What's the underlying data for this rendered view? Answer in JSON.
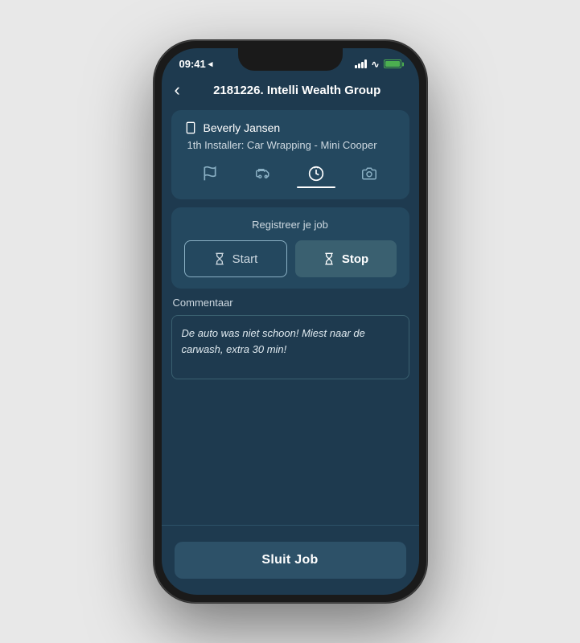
{
  "status_bar": {
    "time": "09:41",
    "location_icon": "◂",
    "wifi_icon": "wifi",
    "battery_label": "battery"
  },
  "header": {
    "back_label": "‹",
    "title_number": "2181226.",
    "title_name": " Intelli Wealth Group"
  },
  "customer": {
    "name": "Beverly Jansen",
    "installer_text": "1th Installer: Car Wrapping - Mini Cooper"
  },
  "tabs": [
    {
      "id": "flag",
      "icon": "🚩",
      "label": "flag",
      "active": false
    },
    {
      "id": "car",
      "icon": "🚗",
      "label": "car",
      "active": false
    },
    {
      "id": "clock",
      "icon": "⏰",
      "label": "clock",
      "active": true
    },
    {
      "id": "camera",
      "icon": "📷",
      "label": "camera",
      "active": false
    }
  ],
  "job_register": {
    "title": "Registreer je job",
    "start_label": "Start",
    "stop_label": "Stop"
  },
  "comment": {
    "label": "Commentaar",
    "text": "De auto was niet schoon! Miest naar de carwash, extra 30 min!"
  },
  "footer": {
    "sluit_label": "Sluit Job"
  }
}
